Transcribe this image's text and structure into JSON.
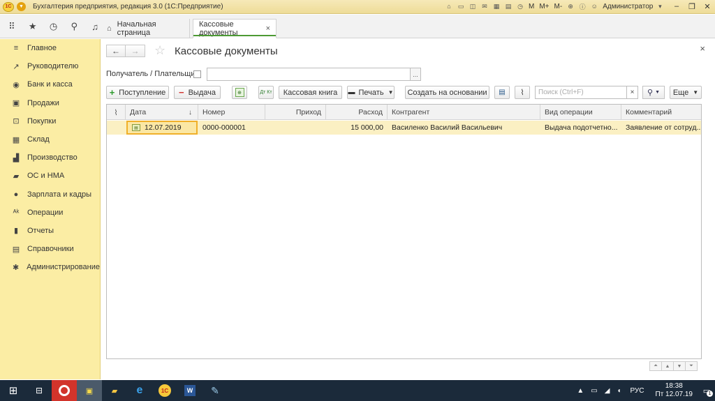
{
  "window": {
    "title": "Бухгалтерия предприятия, редакция 3.0  (1С:Предприятие)",
    "logo": "1С",
    "user": "Администратор",
    "memory_buttons": [
      "M",
      "M+",
      "M-"
    ],
    "icons": [
      "home-icon",
      "print-icon",
      "preview-icon",
      "mail-icon",
      "calc-icon",
      "calendar-icon",
      "history-icon",
      "zoom-icon",
      "info-icon",
      "user-icon",
      "chevron-down-icon",
      "minimize-icon",
      "restore-icon",
      "close-icon"
    ]
  },
  "tabs": {
    "home": "Начальная страница",
    "active": "Кассовые документы",
    "active_close": "×",
    "accent": "#4c9a34"
  },
  "sidebar": {
    "items": [
      {
        "label": "Главное",
        "icon": "menu-lines-icon",
        "glyph": "≡"
      },
      {
        "label": "Руководителю",
        "icon": "trend-icon",
        "glyph": "↗"
      },
      {
        "label": "Банк и касса",
        "icon": "coin-icon",
        "glyph": "◉"
      },
      {
        "label": "Продажи",
        "icon": "bag-icon",
        "glyph": "▣"
      },
      {
        "label": "Покупки",
        "icon": "cart-icon",
        "glyph": "⊡"
      },
      {
        "label": "Склад",
        "icon": "warehouse-icon",
        "glyph": "▦"
      },
      {
        "label": "Производство",
        "icon": "factory-icon",
        "glyph": "▟"
      },
      {
        "label": "ОС и НМА",
        "icon": "truck-icon",
        "glyph": "▰"
      },
      {
        "label": "Зарплата и кадры",
        "icon": "person-icon",
        "glyph": "●"
      },
      {
        "label": "Операции",
        "icon": "dtkt-icon",
        "glyph": "ᴬᵏ"
      },
      {
        "label": "Отчеты",
        "icon": "bar-chart-icon",
        "glyph": "▮"
      },
      {
        "label": "Справочники",
        "icon": "books-icon",
        "glyph": "▤"
      },
      {
        "label": "Администрирование",
        "icon": "gear-icon",
        "glyph": "✱"
      }
    ],
    "bg": "#fbeda4"
  },
  "page": {
    "title": "Кассовые документы",
    "close": "×",
    "filter_label": "Получатель / Плательщик:",
    "filter_value": "",
    "filter_more": "..."
  },
  "toolbar": {
    "income": "Поступление",
    "income_sign": "+",
    "expense": "Выдача",
    "expense_sign": "−",
    "cash_book": "Кассовая книга",
    "print": "Печать",
    "create_based": "Создать на основании",
    "search_placeholder": "Поиск (Ctrl+F)",
    "search_clear": "×",
    "more": "Еще",
    "dtkt": "Дт Кт"
  },
  "table": {
    "columns": [
      "Дата",
      "Номер",
      "Приход",
      "Расход",
      "Контрагент",
      "Вид операции",
      "Комментарий"
    ],
    "sort_indicator": "↓",
    "rows": [
      {
        "date": "12.07.2019",
        "number": "0000-000001",
        "income": "",
        "expense": "15 000,00",
        "counterparty": "Василенко Василий Васильевич",
        "operation": "Выдача подотчетно...",
        "comment": "Заявление от сотруд..."
      }
    ]
  },
  "taskbar": {
    "lang": "РУС",
    "time": "18:38",
    "date": "Пт 12.07.19",
    "notifications": "1",
    "word_label": "W",
    "onec_label": "1С"
  }
}
